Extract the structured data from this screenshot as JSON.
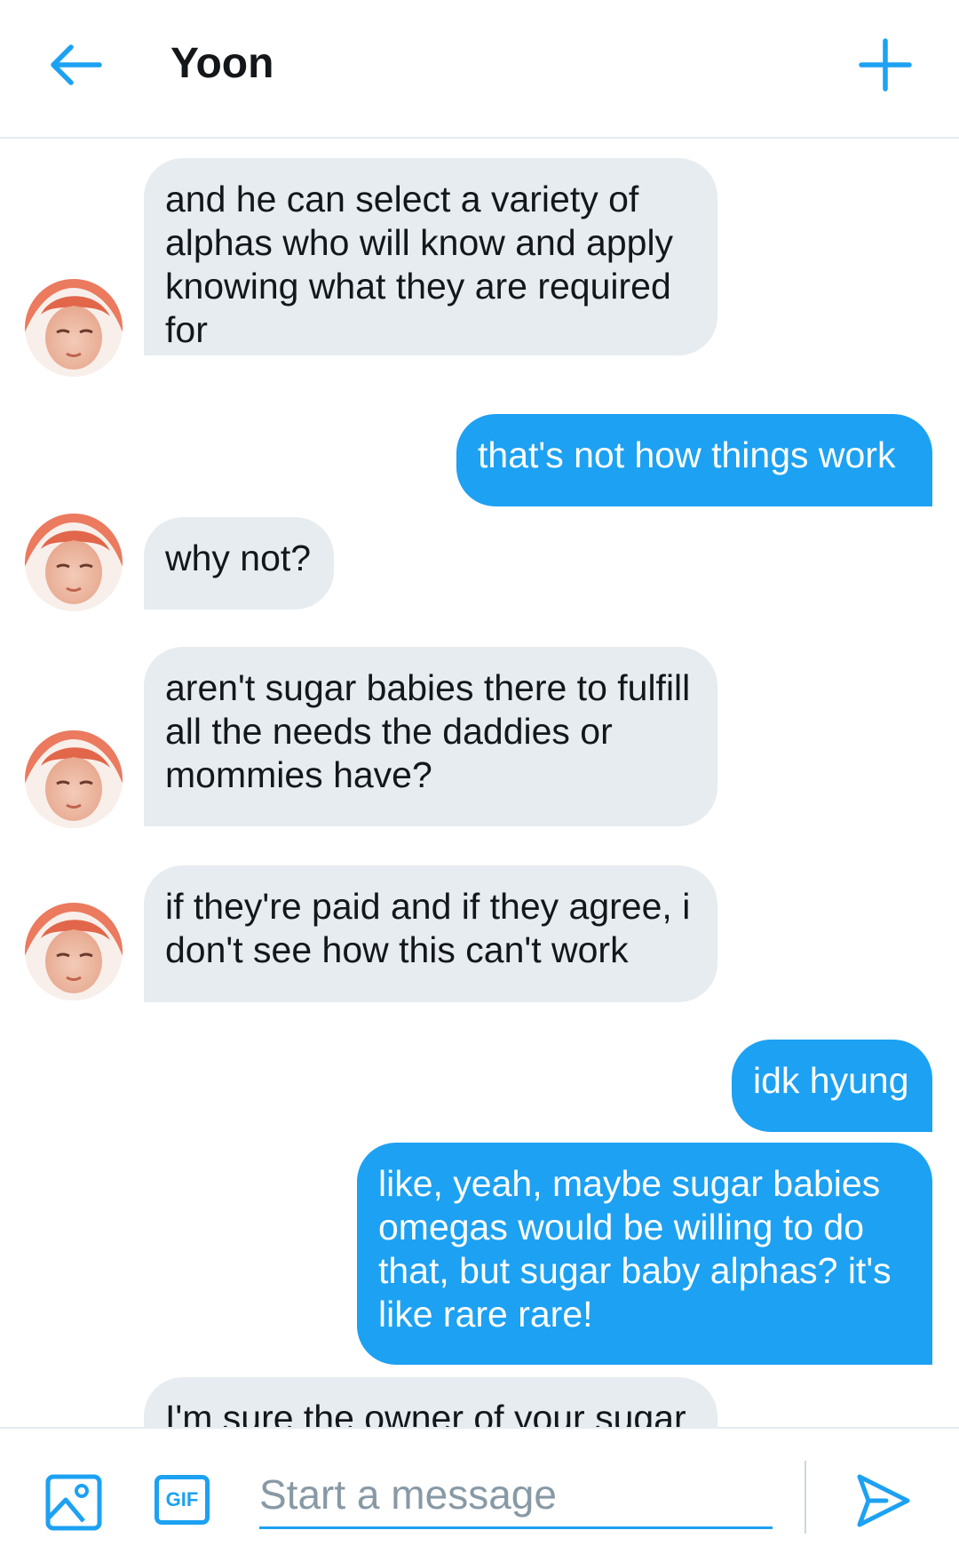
{
  "header": {
    "title": "Yoon",
    "back_icon": "arrow-left-icon",
    "new_icon": "plus-icon"
  },
  "colors": {
    "accent": "#1da1f2",
    "incoming_bubble": "#e6ecf0",
    "text": "#14171a",
    "placeholder": "#8899a6"
  },
  "messages": [
    {
      "from": "Yoon",
      "text": "and he can select a variety of alphas who will know and apply knowing what they are required for"
    },
    {
      "from": "me",
      "text": "that's not how things work"
    },
    {
      "from": "Yoon",
      "text": "why not?"
    },
    {
      "from": "Yoon",
      "text": "aren't sugar babies there to fulfill all the needs the daddies or mommies have?"
    },
    {
      "from": "Yoon",
      "text": "if they're paid and if they agree, i don't see how this can't work"
    },
    {
      "from": "me",
      "text": "idk hyung"
    },
    {
      "from": "me",
      "text": "like, yeah, maybe sugar babies omegas would be willing to do that, but sugar baby alphas? it's like rare rare!"
    },
    {
      "from": "Yoon",
      "text": "I'm sure the owner of your sugar"
    }
  ],
  "composer": {
    "image_icon": "image-icon",
    "gif_label": "GIF",
    "placeholder": "Start a message",
    "send_icon": "send-icon"
  }
}
